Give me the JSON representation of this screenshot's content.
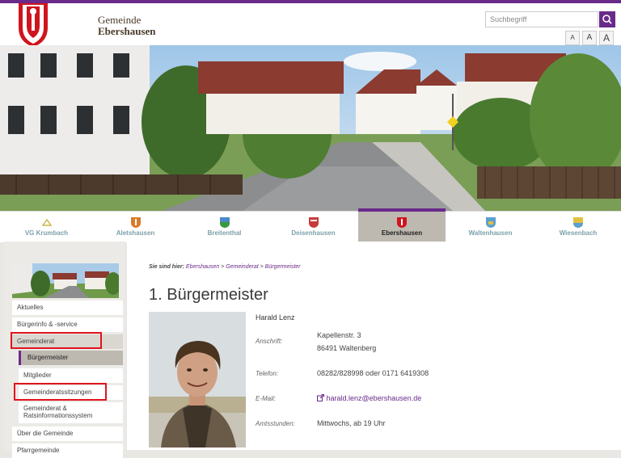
{
  "header": {
    "brand_line1": "Gemeinde",
    "brand_line2": "Ebershausen",
    "search_placeholder": "Suchbegriff",
    "font_sizes": [
      "A",
      "A",
      "A"
    ]
  },
  "nav": {
    "items": [
      {
        "label": "VG Krumbach",
        "active": false
      },
      {
        "label": "Aletshausen",
        "active": false
      },
      {
        "label": "Breitenthal",
        "active": false
      },
      {
        "label": "Deisenhausen",
        "active": false
      },
      {
        "label": "Ebershausen",
        "active": true
      },
      {
        "label": "Waltenhausen",
        "active": false
      },
      {
        "label": "Wiesenbach",
        "active": false
      }
    ]
  },
  "sidebar": {
    "items": [
      {
        "label": "Aktuelles"
      },
      {
        "label": "Bürgerinfo & -service"
      },
      {
        "label": "Gemeinderat"
      },
      {
        "label": "Bürgermeister"
      },
      {
        "label": "Mitglieder"
      },
      {
        "label": "Gemeinderatssitzungen"
      },
      {
        "label": "Gemeinderat & Ratsinformationssystem"
      },
      {
        "label": "Über die Gemeinde"
      },
      {
        "label": "Pfarrgemeinde"
      }
    ]
  },
  "breadcrumb": {
    "prefix": "Sie sind hier:",
    "items": [
      "Ebershausen",
      "Gemeinderat",
      "Bürgermeister"
    ],
    "separator": ">"
  },
  "page": {
    "title": "1. Bürgermeister",
    "name": "Harald Lenz",
    "fields": {
      "address_label": "Anschrift:",
      "address_line1": "Kapellenstr. 3",
      "address_line2": "86491 Waltenberg",
      "phone_label": "Telefon:",
      "phone": "08282/828998 oder 0171 6419308",
      "email_label": "E-Mail:",
      "email": "harald.lenz@ebershausen.de",
      "hours_label": "Amtsstunden:",
      "hours": "Mittwochs, ab 19 Uhr"
    }
  },
  "colors": {
    "accent": "#6a2a8a",
    "marker": "#e0141e"
  }
}
